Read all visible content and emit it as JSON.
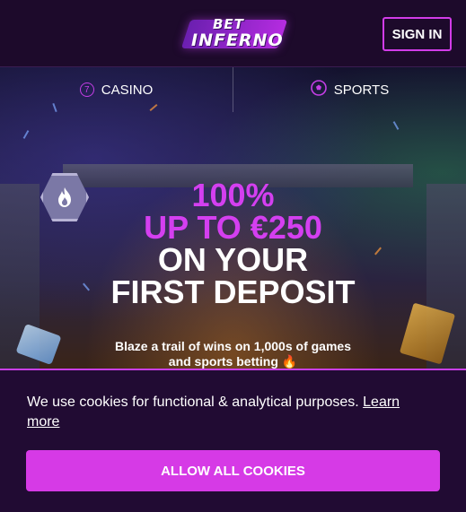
{
  "header": {
    "logo_top": "BET",
    "logo_bottom": "INFERNO",
    "signin_label": "SIGN IN"
  },
  "nav": {
    "casino_label": "CASINO",
    "casino_icon_glyph": "7",
    "sports_label": "SPORTS"
  },
  "promo": {
    "line1": "100%",
    "line2": "UP TO €250",
    "line3": "ON YOUR",
    "line4": "FIRST DEPOSIT",
    "tagline_line1": "Blaze a trail of wins on 1,000s of games",
    "tagline_line2": "and sports betting 🔥"
  },
  "cookie": {
    "text": "We use cookies for functional & analytical purposes.",
    "learn_more": "Learn more",
    "allow_label": "ALLOW ALL COOKIES"
  },
  "colors": {
    "accent": "#d43ff0",
    "background": "#1e0a2c"
  }
}
